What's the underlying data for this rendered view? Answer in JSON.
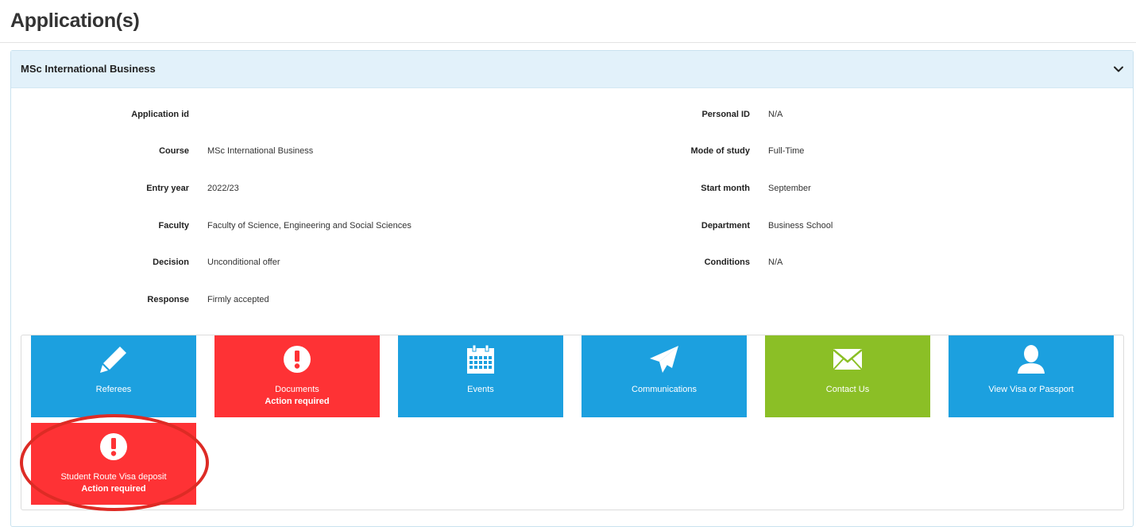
{
  "page": {
    "title": "Application(s)"
  },
  "application": {
    "heading": "MSc International Business",
    "fields_left": [
      {
        "label": "Application id",
        "value": ""
      },
      {
        "label": "Course",
        "value": "MSc International Business"
      },
      {
        "label": "Entry year",
        "value": "2022/23"
      },
      {
        "label": "Faculty",
        "value": "Faculty of Science, Engineering and Social Sciences"
      },
      {
        "label": "Decision",
        "value": "Unconditional offer"
      },
      {
        "label": "Response",
        "value": "Firmly accepted"
      }
    ],
    "fields_right": [
      {
        "label": "Personal ID",
        "value": "N/A"
      },
      {
        "label": "Mode of study",
        "value": "Full-Time"
      },
      {
        "label": "Start month",
        "value": "September"
      },
      {
        "label": "Department",
        "value": "Business School"
      },
      {
        "label": "Conditions",
        "value": "N/A"
      }
    ]
  },
  "tiles": [
    {
      "label": "Referees",
      "status": "",
      "color": "#1ca0df",
      "icon": "pencil-icon"
    },
    {
      "label": "Documents",
      "status": "Action required",
      "color": "#fe3235",
      "icon": "exclamation-circle-icon"
    },
    {
      "label": "Events",
      "status": "",
      "color": "#1ca0df",
      "icon": "calendar-icon"
    },
    {
      "label": "Communications",
      "status": "",
      "color": "#1ca0df",
      "icon": "paper-plane-icon"
    },
    {
      "label": "Contact Us",
      "status": "",
      "color": "#8bbf26",
      "icon": "envelope-icon"
    },
    {
      "label": "View Visa or Passport",
      "status": "",
      "color": "#1ca0df",
      "icon": "user-icon"
    },
    {
      "label": "Student Route Visa deposit",
      "status": "Action required",
      "color": "#fe3235",
      "icon": "exclamation-circle-icon"
    }
  ],
  "annotation": {
    "color": "#dd2b25"
  }
}
